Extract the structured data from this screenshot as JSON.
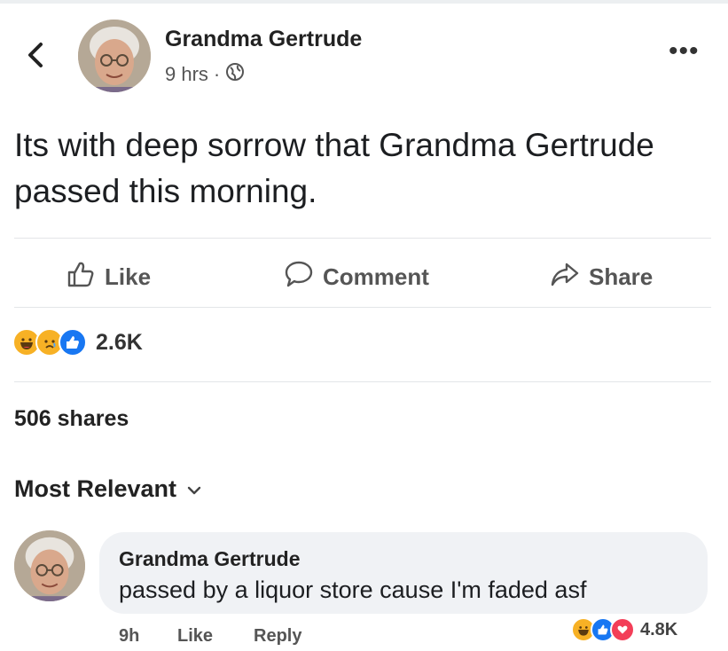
{
  "post": {
    "author": "Grandma Gertrude",
    "time": "9 hrs",
    "separator": "·",
    "text": "Its with deep sorrow that Grandma Gertrude passed this morning."
  },
  "actions": {
    "like": "Like",
    "comment": "Comment",
    "share": "Share"
  },
  "reactions": {
    "count": "2.6K",
    "types": [
      "haha",
      "sad",
      "like"
    ]
  },
  "shares": "506 shares",
  "sort_label": "Most Relevant",
  "comment": {
    "author": "Grandma Gertrude",
    "text": "passed by a liquor store cause I'm faded asf",
    "time": "9h",
    "like": "Like",
    "reply": "Reply",
    "reaction_count": "4.8K",
    "reaction_types": [
      "haha",
      "like",
      "love"
    ]
  },
  "colors": {
    "like_blue": "#1877f2",
    "love_red": "#f33e58",
    "haha_yellow": "#f7b125",
    "text": "#1c1e21",
    "bubble": "#f0f2f5"
  }
}
